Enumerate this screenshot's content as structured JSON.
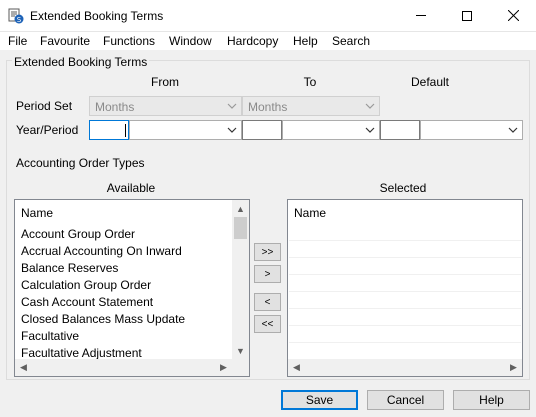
{
  "window": {
    "title": "Extended Booking Terms",
    "icon": "app-booking-icon"
  },
  "menu": [
    "File",
    "Favourite",
    "Functions",
    "Window",
    "Hardcopy",
    "Help",
    "Search"
  ],
  "group": {
    "label": "Extended Booking Terms",
    "col_from": "From",
    "col_to": "To",
    "col_default": "Default",
    "period_set_label": "Period Set",
    "period_set_from": "Months",
    "period_set_to": "Months",
    "year_period_label": "Year/Period",
    "year_from": "",
    "year_to": "",
    "year_default": ""
  },
  "order_types": {
    "label": "Accounting Order Types",
    "available_label": "Available",
    "selected_label": "Selected",
    "available_header": "Name",
    "selected_header": "Name",
    "available_items": [
      "Account Group Order",
      "Accrual Accounting On Inward",
      "Balance Reserves",
      "Calculation Group Order",
      "Cash Account Statement",
      "Closed Balances Mass Update",
      "Facultative",
      "Facultative Adjustment"
    ],
    "selected_items": []
  },
  "transfer": {
    "add_all": ">>",
    "add": ">",
    "remove": "<",
    "remove_all": "<<"
  },
  "buttons": {
    "save": "Save",
    "cancel": "Cancel",
    "help": "Help"
  }
}
